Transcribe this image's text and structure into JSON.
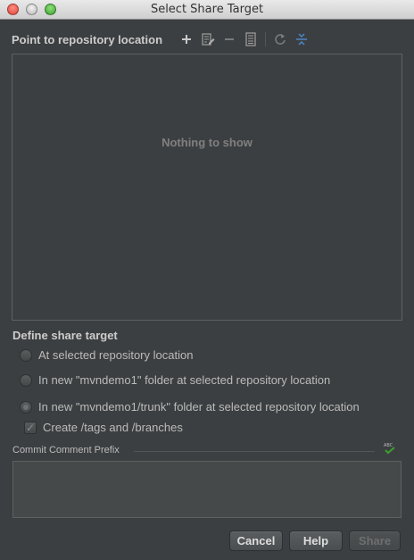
{
  "window": {
    "title": "Select Share Target"
  },
  "repo": {
    "header": "Point to repository location",
    "empty_text": "Nothing to show",
    "toolbar_icons": [
      "add-icon",
      "edit-icon",
      "remove-icon",
      "details-icon",
      "refresh-icon",
      "collapse-icon"
    ]
  },
  "share_target": {
    "header": "Define share target",
    "options": [
      {
        "label": "At selected repository location",
        "checked": false
      },
      {
        "label": "In new \"mvndemo1\" folder at selected repository location",
        "checked": false
      },
      {
        "label": "In new \"mvndemo1/trunk\" folder at selected repository location",
        "checked": true
      }
    ],
    "create_tags_label": "Create /tags and /branches",
    "create_tags_checked": true
  },
  "commit": {
    "label": "Commit Comment Prefix",
    "spellcheck_icon_text": "ABC",
    "value": ""
  },
  "buttons": {
    "cancel": "Cancel",
    "help": "Help",
    "share": "Share"
  },
  "colors": {
    "background": "#3c3f41",
    "accent": "#3aa12e",
    "toolbar_blue": "#4a88c7"
  }
}
